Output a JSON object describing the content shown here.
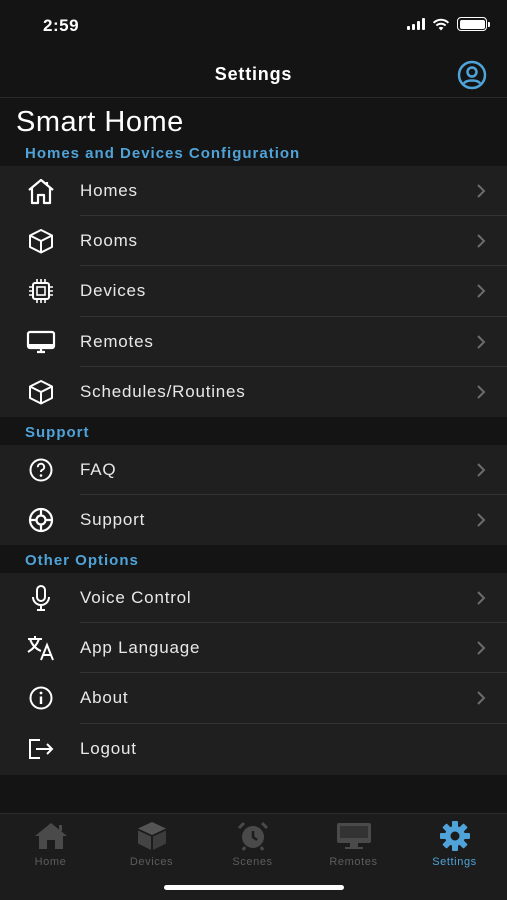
{
  "status_bar": {
    "time": "2:59"
  },
  "nav": {
    "title": "Settings",
    "profile_icon": "account-circle-icon"
  },
  "page": {
    "heading": "Smart Home"
  },
  "colors": {
    "accent": "#4fa3d8",
    "background": "#141414",
    "row_background": "#1f1f1f",
    "inactive_tab": "#5d5d5d"
  },
  "sections": {
    "config": {
      "title": "Homes and Devices Configuration",
      "items": [
        {
          "label": "Homes",
          "icon": "house-icon"
        },
        {
          "label": "Rooms",
          "icon": "cube-icon"
        },
        {
          "label": "Devices",
          "icon": "chip-icon"
        },
        {
          "label": "Remotes",
          "icon": "monitor-icon"
        },
        {
          "label": "Schedules/Routines",
          "icon": "cube-icon"
        }
      ]
    },
    "support": {
      "title": "Support",
      "items": [
        {
          "label": "FAQ",
          "icon": "question-circle-icon"
        },
        {
          "label": "Support",
          "icon": "lifebuoy-icon"
        }
      ]
    },
    "other": {
      "title": "Other Options",
      "items": [
        {
          "label": "Voice Control",
          "icon": "microphone-icon"
        },
        {
          "label": "App Language",
          "icon": "translate-icon"
        },
        {
          "label": "About",
          "icon": "info-circle-icon"
        },
        {
          "label": "Logout",
          "icon": "logout-icon"
        }
      ]
    }
  },
  "tab_bar": {
    "tabs": [
      {
        "label": "Home",
        "icon": "home-icon",
        "active": false
      },
      {
        "label": "Devices",
        "icon": "box-icon",
        "active": false
      },
      {
        "label": "Scenes",
        "icon": "alarm-clock-icon",
        "active": false
      },
      {
        "label": "Remotes",
        "icon": "monitor-icon",
        "active": false
      },
      {
        "label": "Settings",
        "icon": "gear-icon",
        "active": true
      }
    ]
  }
}
